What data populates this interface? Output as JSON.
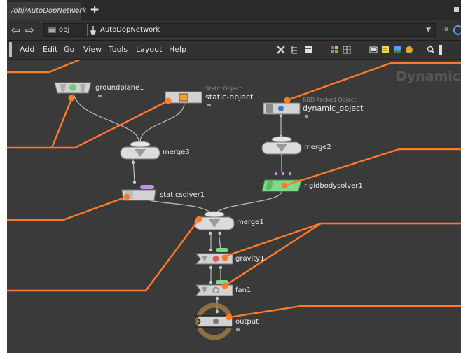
{
  "tab": {
    "title": "/obj/AutoDopNetwork",
    "close": "×",
    "add": "+"
  },
  "path": {
    "root": "obj",
    "current": "AutoDopNetwork"
  },
  "menu": [
    "Add",
    "Edit",
    "Go",
    "View",
    "Tools",
    "Layout",
    "Help"
  ],
  "context_label": "Dynamics",
  "nodes": {
    "groundplane": {
      "label": "groundplane1"
    },
    "static_object": {
      "label": "static-object",
      "sub": "Static Object"
    },
    "dynamic_object": {
      "label": "dynamic_object",
      "sub": "RBD Packed Object"
    },
    "merge3": {
      "label": "merge3"
    },
    "merge2": {
      "label": "merge2"
    },
    "staticsolver": {
      "label": "staticsolver1"
    },
    "rigidbodysolver": {
      "label": "rigidbodysolver1"
    },
    "merge1": {
      "label": "merge1"
    },
    "gravity": {
      "label": "gravity1"
    },
    "fan": {
      "label": "fan1"
    },
    "output": {
      "label": "output"
    }
  },
  "colors": {
    "callout": "#ff7a2a",
    "wire": "#bdbdbd",
    "rbd_node": "#7fd98a"
  }
}
